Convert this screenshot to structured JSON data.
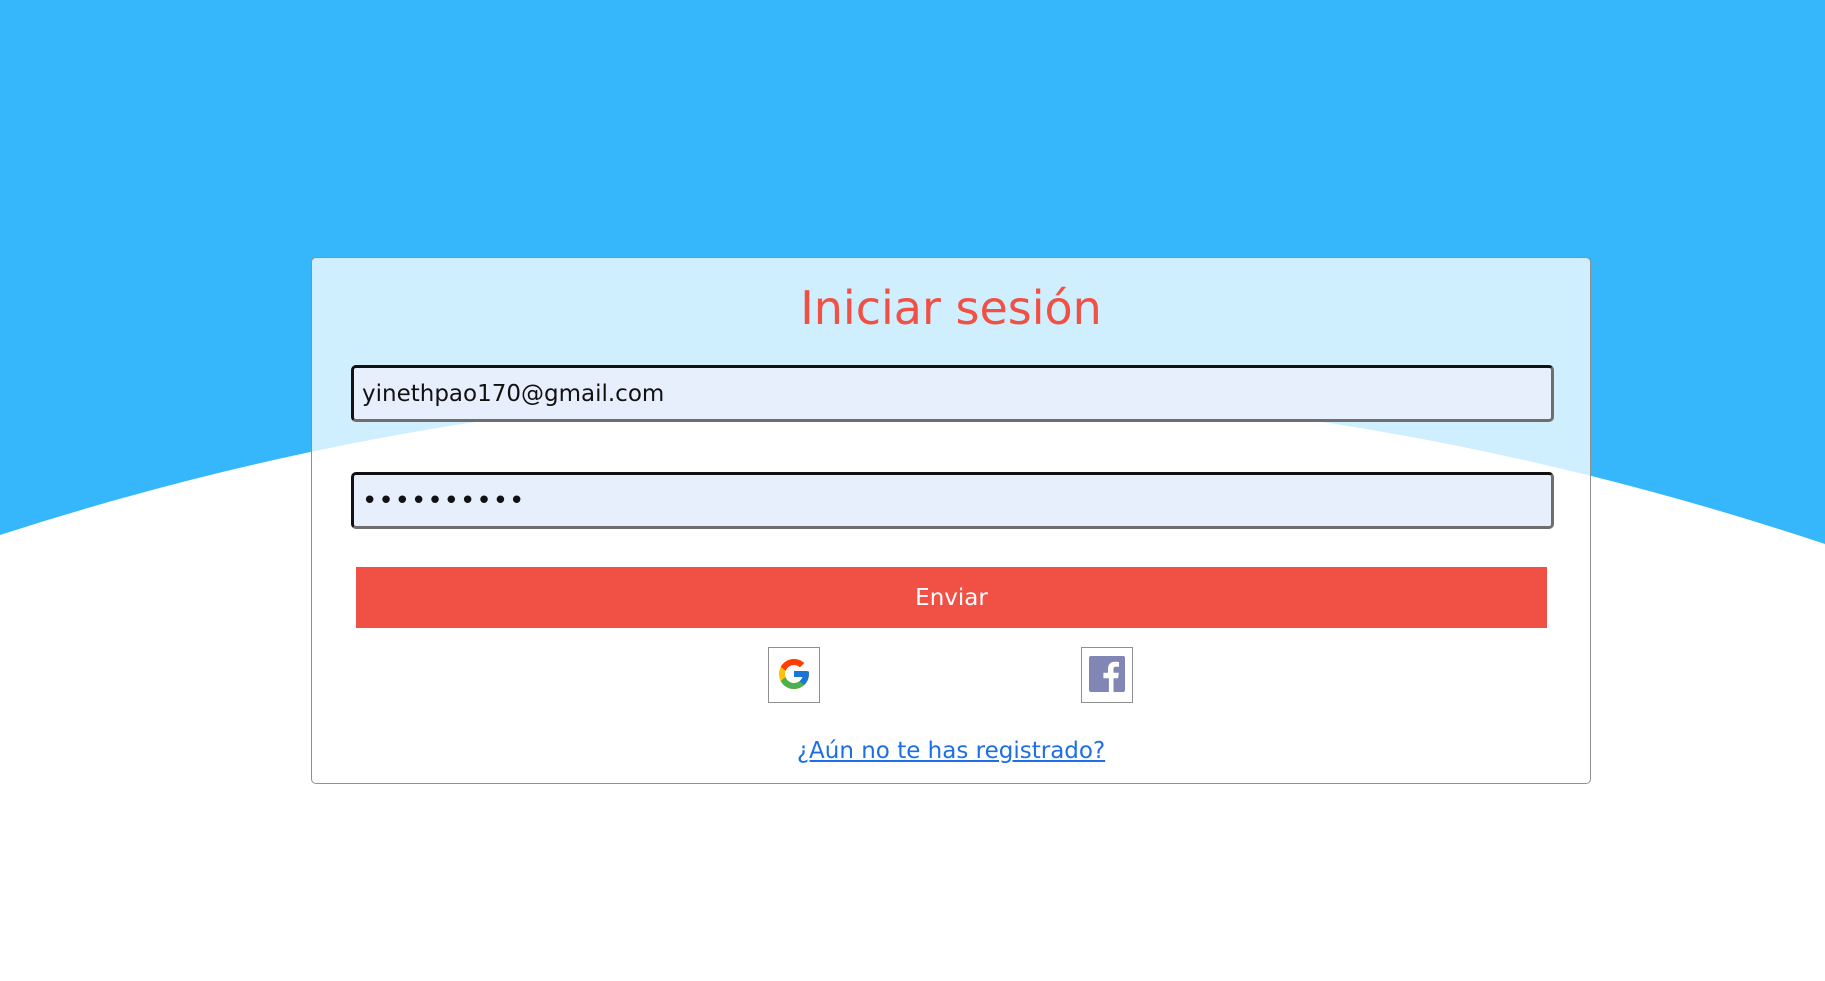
{
  "colors": {
    "background_top": "#36b7fb",
    "background_bottom": "#ffffff",
    "title": "#f15045",
    "submit_button": "#f15045",
    "link": "#1c6fe6",
    "input_fill": "#e8effc",
    "facebook": "#8186b4"
  },
  "login": {
    "title": "Iniciar sesión",
    "email_value": "yinethpao170@gmail.com",
    "password_value": "••••••••••",
    "submit_label": "Enviar",
    "social": [
      {
        "name": "Google",
        "icon": "google-icon"
      },
      {
        "name": "Facebook",
        "icon": "facebook-icon"
      }
    ],
    "register_link": "¿Aún no te has registrado?"
  }
}
